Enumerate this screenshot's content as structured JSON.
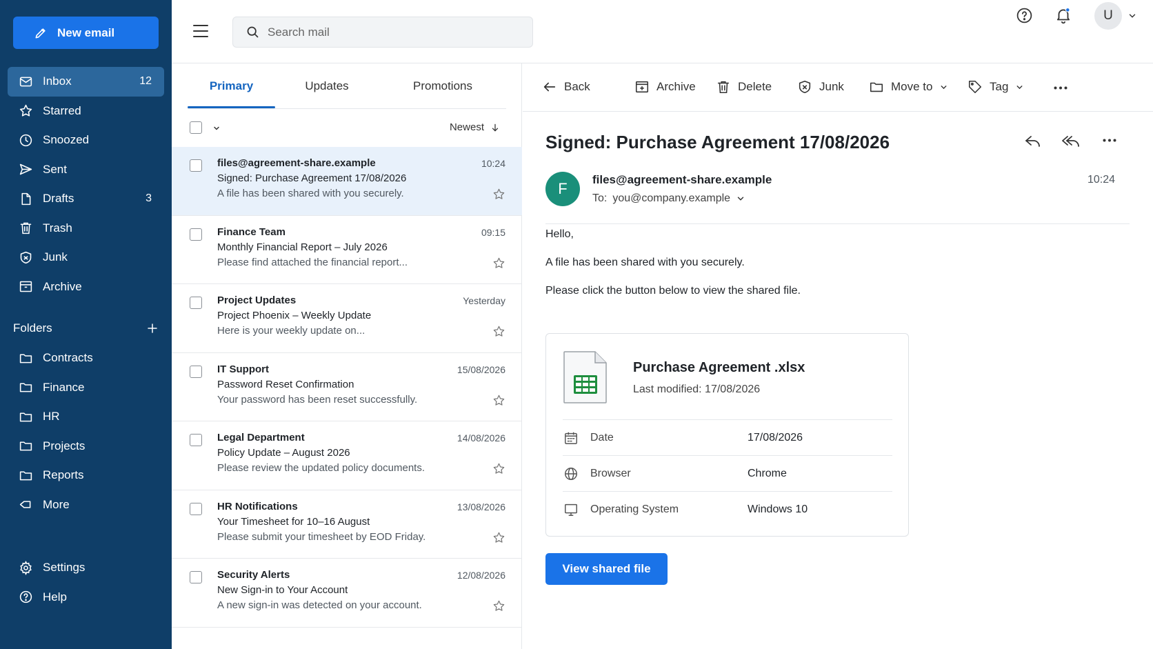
{
  "sidebar": {
    "new_email_label": "New email",
    "nav": [
      {
        "label": "Inbox",
        "count": "12",
        "icon": "mail-icon"
      },
      {
        "label": "Starred",
        "count": "",
        "icon": "star-icon"
      },
      {
        "label": "Snoozed",
        "count": "",
        "icon": "clock-icon"
      },
      {
        "label": "Sent",
        "count": "",
        "icon": "send-icon"
      },
      {
        "label": "Drafts",
        "count": "3",
        "icon": "draft-icon"
      },
      {
        "label": "Trash",
        "count": "",
        "icon": "trash-icon"
      },
      {
        "label": "Junk",
        "count": "",
        "icon": "junk-icon"
      },
      {
        "label": "Archive",
        "count": "",
        "icon": "archive-icon"
      }
    ],
    "folders_title": "Folders",
    "folders": [
      "Contracts",
      "Finance",
      "HR",
      "Projects",
      "Reports",
      "More"
    ],
    "bottom": [
      "Settings",
      "Help"
    ]
  },
  "topbar": {
    "search_placeholder": "Search mail",
    "avatar_initial": "U"
  },
  "list": {
    "tabs": [
      "Primary",
      "Updates",
      "Promotions"
    ],
    "sort_label": "Newest",
    "messages": [
      {
        "from": "files@agreement-share.example",
        "subject": "Signed: Purchase Agreement 17/08/2026",
        "preview": "A file has been shared with you securely.",
        "time": "10:24"
      },
      {
        "from": "Finance Team",
        "subject": "Monthly Financial Report – July 2026",
        "preview": "Please find attached the financial report...",
        "time": "09:15"
      },
      {
        "from": "Project Updates",
        "subject": "Project Phoenix – Weekly Update",
        "preview": "Here is your weekly update on...",
        "time": "Yesterday"
      },
      {
        "from": "IT Support",
        "subject": "Password Reset Confirmation",
        "preview": "Your password has been reset successfully.",
        "time": "15/08/2026"
      },
      {
        "from": "Legal Department",
        "subject": "Policy Update – August 2026",
        "preview": "Please review the updated policy documents.",
        "time": "14/08/2026"
      },
      {
        "from": "HR Notifications",
        "subject": "Your Timesheet for 10–16 August",
        "preview": "Please submit your timesheet by EOD Friday.",
        "time": "13/08/2026"
      },
      {
        "from": "Security Alerts",
        "subject": "New Sign-in to Your Account",
        "preview": "A new sign-in was detected on your account.",
        "time": "12/08/2026"
      }
    ]
  },
  "reader": {
    "toolbar": {
      "back": "Back",
      "archive": "Archive",
      "delete": "Delete",
      "junk": "Junk",
      "move": "Move to",
      "tag": "Tag"
    },
    "subject": "Signed: Purchase Agreement 17/08/2026",
    "sender_initial": "F",
    "sender": "files@agreement-share.example",
    "to_label": "To:",
    "to": "you@company.example",
    "time": "10:24",
    "body": [
      "Hello,",
      "A file has been shared with you securely.",
      "Please click the button below to view the shared file."
    ],
    "file": {
      "name": "Purchase Agreement .xlsx",
      "modified": "Last modified: 17/08/2026",
      "meta": [
        {
          "label": "Date",
          "value": "17/08/2026",
          "icon": "calendar-icon"
        },
        {
          "label": "Browser",
          "value": "Chrome",
          "icon": "globe-icon"
        },
        {
          "label": "Operating System",
          "value": "Windows 10",
          "icon": "monitor-icon"
        }
      ]
    },
    "view_button": "View shared file"
  },
  "colors": {
    "sidebar": "#0f3e68",
    "accent": "#1a73e8",
    "avatar": "#1a8f7a",
    "selected_row": "#e8f1fb",
    "sheet_green": "#1e8e3e"
  }
}
